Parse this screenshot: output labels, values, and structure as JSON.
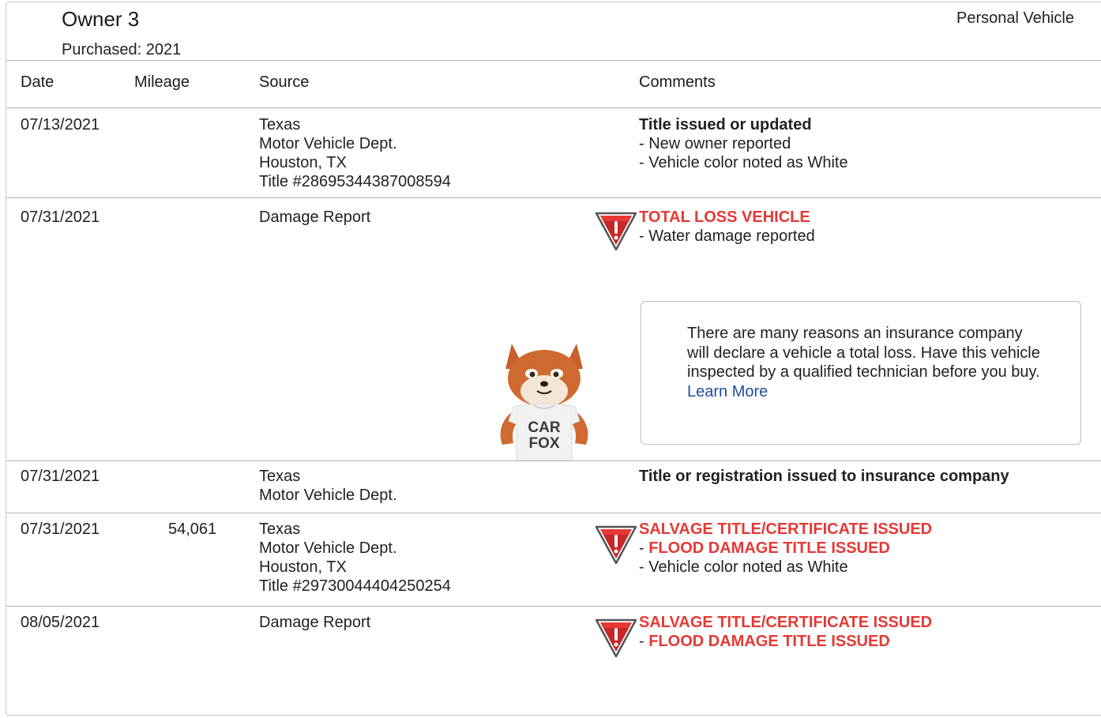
{
  "owner": {
    "title": "Owner 3",
    "purchased": "Purchased: 2021",
    "type": "Personal Vehicle"
  },
  "columns": {
    "date": "Date",
    "mileage": "Mileage",
    "source": "Source",
    "comments": "Comments"
  },
  "rows": [
    {
      "date": "07/13/2021",
      "mileage": "",
      "source": [
        "Texas",
        "Motor Vehicle Dept.",
        "Houston, TX",
        "Title #28695344387008594"
      ],
      "comment_title": "Title issued or updated",
      "comments": [
        "- New owner reported",
        "- Vehicle color noted as White"
      ]
    },
    {
      "date": "07/31/2021",
      "mileage": "",
      "source": [
        "Damage Report"
      ],
      "alert_title": "TOTAL LOSS VEHICLE",
      "comments": [
        "- Water damage reported"
      ],
      "callout": {
        "text": "There are many reasons an insurance company will declare a vehicle a total loss. Have this vehicle inspected by a qualified technician before you buy.",
        "link": "Learn More"
      },
      "mascot_text": [
        "CAR",
        "FOX"
      ]
    },
    {
      "date": "07/31/2021",
      "mileage": "",
      "source": [
        "Texas",
        "Motor Vehicle Dept."
      ],
      "comment_title": "Title or registration issued to insurance company"
    },
    {
      "date": "07/31/2021",
      "mileage": "54,061",
      "source": [
        "Texas",
        "Motor Vehicle Dept.",
        "Houston, TX",
        "Title #29730044404250254"
      ],
      "alert_title": "SALVAGE TITLE/CERTIFICATE ISSUED",
      "alert_sub_prefix": "- ",
      "alert_sub": "FLOOD DAMAGE TITLE ISSUED",
      "comments": [
        "- Vehicle color noted as White"
      ]
    },
    {
      "date": "08/05/2021",
      "mileage": "",
      "source": [
        "Damage Report"
      ],
      "alert_title": "SALVAGE TITLE/CERTIFICATE ISSUED",
      "alert_sub_prefix": "- ",
      "alert_sub": "FLOOD DAMAGE TITLE ISSUED"
    }
  ],
  "colors": {
    "alert_red": "#e53935",
    "link_blue": "#1e4fa0",
    "divider": "#b5b5b5"
  },
  "icons": {
    "warning": "warning-triangle-icon",
    "mascot": "carfox-mascot"
  }
}
